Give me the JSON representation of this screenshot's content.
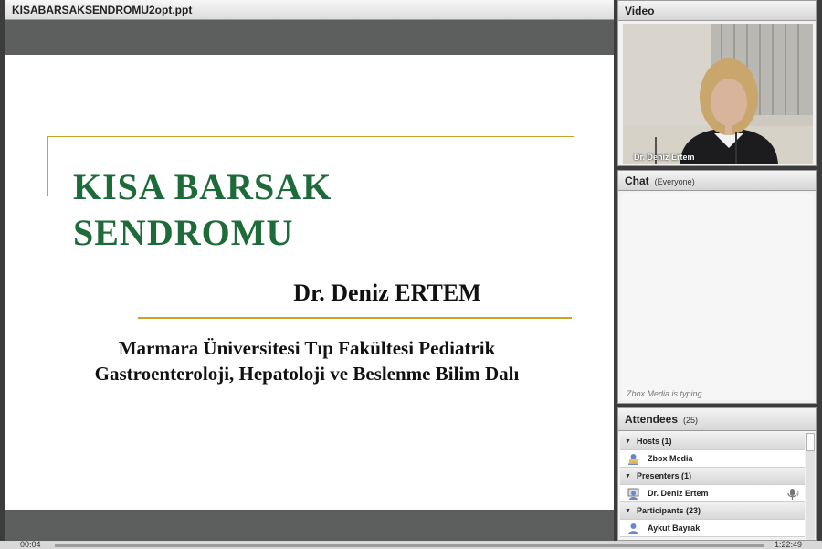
{
  "share": {
    "title": "KISABARSAKSENDROMU2opt.ppt",
    "slide": {
      "title_line1": "KISA BARSAK",
      "title_line2": "SENDROMU",
      "author": "Dr. Deniz ERTEM",
      "affiliation_line1": "Marmara Üniversitesi Tıp Fakültesi Pediatrik",
      "affiliation_line2": "Gastroenteroloji, Hepatoloji ve Beslenme Bilim Dalı"
    },
    "elapsed": "00:04",
    "total": "1:22:49"
  },
  "video": {
    "title": "Video",
    "name_caption": "Dr. Deniz Ertem"
  },
  "chat": {
    "title": "Chat",
    "scope": "(Everyone)",
    "typing_status": "Zbox Media is typing..."
  },
  "attendees": {
    "title": "Attendees",
    "count": "(25)",
    "groups": [
      {
        "label": "Hosts (1)",
        "member": "Zbox Media"
      },
      {
        "label": "Presenters (1)",
        "member": "Dr. Deniz Ertem"
      },
      {
        "label": "Participants (23)",
        "member": "Aykut Bayrak"
      }
    ]
  },
  "colors": {
    "slide_title_green": "#1e6b3a",
    "slide_rule_gold": "#c9a227"
  },
  "icons": [
    "host-user-icon",
    "presenter-user-icon",
    "participant-user-icon",
    "microphone-icon",
    "expand-triangle-icon"
  ]
}
